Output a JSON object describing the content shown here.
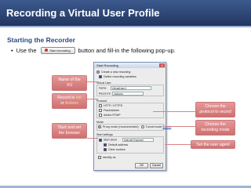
{
  "slide": {
    "title": "Recording a Virtual User Profile",
    "section": "Starting the Recorder",
    "bullet": {
      "prefix": "Use the",
      "button_label": "Start recording",
      "suffix": "button and fill-in the following pop-up."
    }
  },
  "dialog": {
    "title": "Start Recording",
    "create_label": "Create a new recording",
    "define_label": "Define recording variables",
    "vu_group": "Virtual User",
    "name_label": "Name",
    "name_value": "VirtualUser1",
    "record_in_label": "Record in",
    "record_in_value": "Actions",
    "protocol_group": "Protocol",
    "protocols": [
      "HTTP / HTTPS",
      "Flash/Adobe",
      "Adobe RTMP"
    ],
    "mode_group": "Mode",
    "modes": [
      "Proxy mode (recommended)",
      "Tunnel mode"
    ],
    "mode_link": "Details",
    "start_group": "Start settings",
    "start_label": "Start client",
    "start_value": "Internet Explorer",
    "start_options": [
      "Default address",
      "Clear cookies"
    ],
    "identify_label": "Identify as",
    "ok": "OK",
    "cancel": "Cancel"
  },
  "callouts": {
    "name_vu": {
      "line1": "Name of the",
      "line2": "VU"
    },
    "record_in": {
      "line1": "Record in",
      "hl1": "Init",
      "line2": "or",
      "hl2": "Actions"
    },
    "start_browser": {
      "line1": "Start and set",
      "line2": "the browser"
    },
    "protocol": {
      "line1": "Choose the",
      "line2": "protocol to record"
    },
    "mode": {
      "line1": "Choose the",
      "line2": "recording mode"
    },
    "user_agent": {
      "line1": "Set the user agent"
    }
  },
  "colors": {
    "title_bar": "#2d4676",
    "callout": "#d98484",
    "heading": "#2a4a82"
  }
}
